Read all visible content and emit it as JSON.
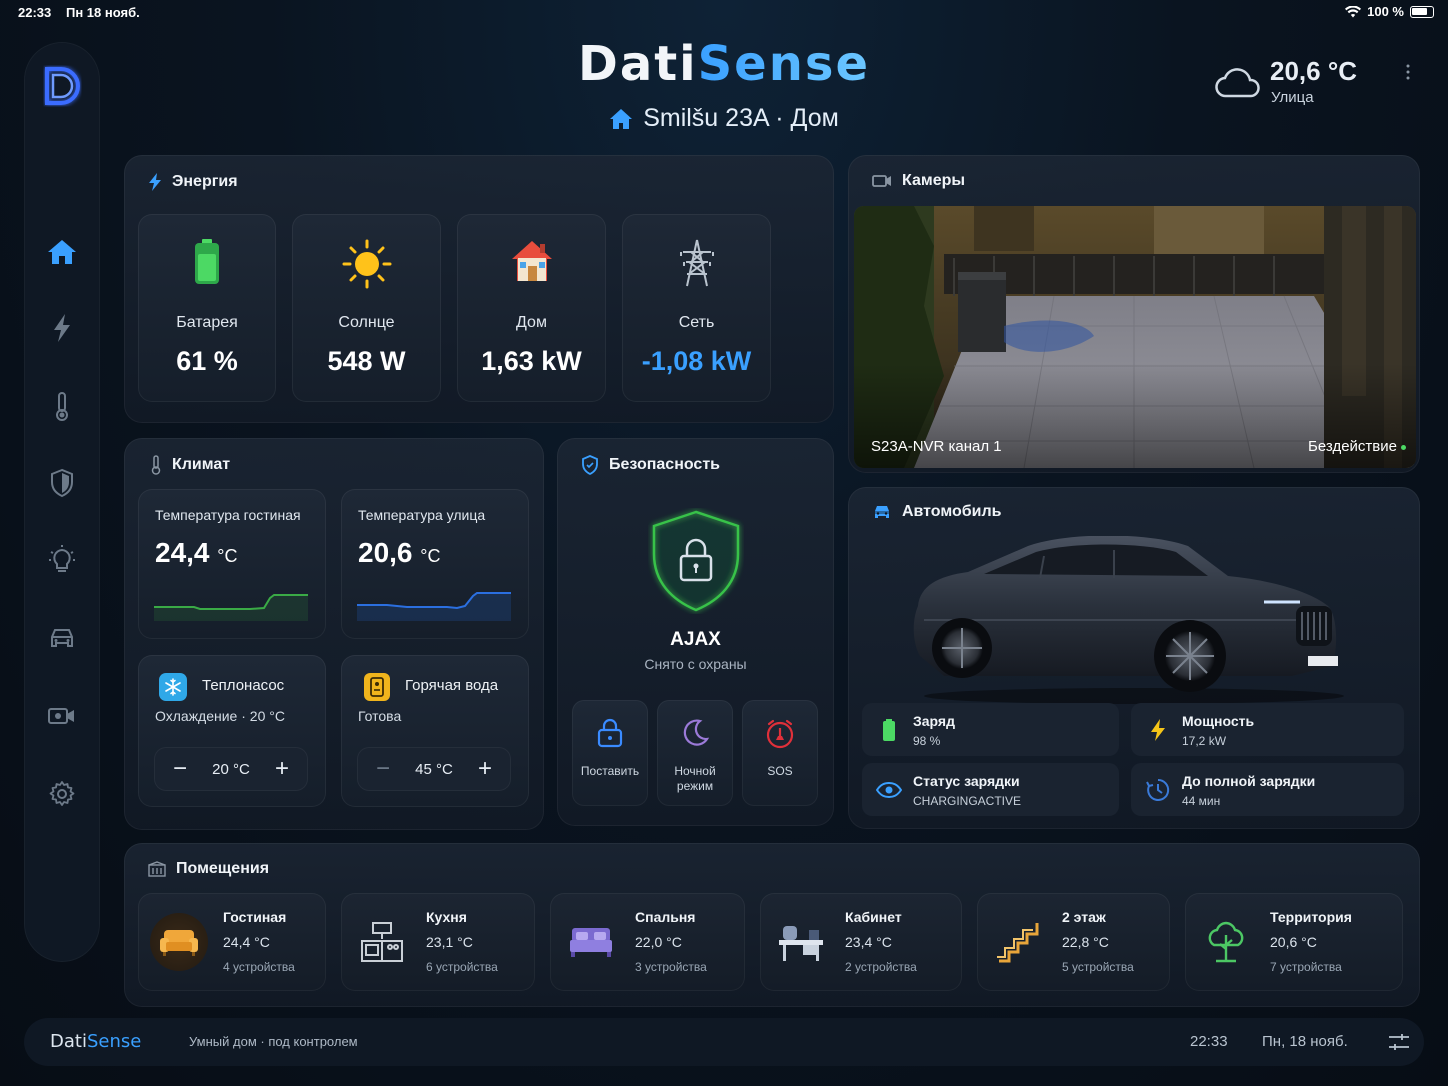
{
  "status_bar": {
    "time": "22:33",
    "date": "Пн 18 нояб.",
    "battery": "100 %"
  },
  "header": {
    "brand_part1": "Dati",
    "brand_part2": "Sense",
    "location": "Smilšu 23A · Дом",
    "weather_temp": "20,6 °C",
    "weather_label": "Улица"
  },
  "energy": {
    "title": "Энергия",
    "tiles": [
      {
        "label": "Батарея",
        "value": "61 %",
        "color": "#ffffff",
        "icon": "battery-icon"
      },
      {
        "label": "Солнце",
        "value": "548 W",
        "color": "#ffffff",
        "icon": "sun-icon"
      },
      {
        "label": "Дом",
        "value": "1,63 kW",
        "color": "#ffffff",
        "icon": "house-icon"
      },
      {
        "label": "Сеть",
        "value": "-1,08 kW",
        "color": "#3aa0ff",
        "icon": "power-tower-icon"
      }
    ]
  },
  "climate": {
    "title": "Климат",
    "living": {
      "label": "Температура гостиная",
      "value": "24,4",
      "unit": "°C"
    },
    "outside": {
      "label": "Температура улица",
      "value": "20,6",
      "unit": "°C"
    },
    "heatpump": {
      "name": "Теплонасос",
      "status": "Охлаждение · 20 °C",
      "setpoint": "20 °C"
    },
    "hotwater": {
      "name": "Горячая вода",
      "status": "Готова",
      "setpoint": "45 °C"
    }
  },
  "security": {
    "title": "Безопасность",
    "system": "AJAX",
    "state": "Снято с охраны",
    "buttons": [
      {
        "label": "Поставить"
      },
      {
        "label": "Ночной режим"
      },
      {
        "label": "SOS"
      }
    ]
  },
  "cameras": {
    "title": "Камеры",
    "channel": "S23A-NVR канал 1",
    "status": "Бездействие"
  },
  "car": {
    "title": "Автомобиль",
    "charge_label": "Заряд",
    "charge_value": "98 %",
    "power_label": "Мощность",
    "power_value": "17,2 kW",
    "charging_status_label": "Статус зарядки",
    "charging_status_value": "CHARGINGACTIVE",
    "full_label": "До полной зарядки",
    "full_value": "44 мин"
  },
  "rooms": {
    "title": "Помещения",
    "items": [
      {
        "name": "Гостиная",
        "temp": "24,4 °C",
        "devices": "4 устройства"
      },
      {
        "name": "Кухня",
        "temp": "23,1 °C",
        "devices": "6 устройства"
      },
      {
        "name": "Спальня",
        "temp": "22,0 °C",
        "devices": "3 устройства"
      },
      {
        "name": "Кабинет",
        "temp": "23,4 °C",
        "devices": "2 устройства"
      },
      {
        "name": "2 этаж",
        "temp": "22,8 °C",
        "devices": "5 устройства"
      },
      {
        "name": "Территория",
        "temp": "20,6 °C",
        "devices": "7 устройства"
      }
    ]
  },
  "footer": {
    "brand_part1": "Dati",
    "brand_part2": "Sense",
    "tagline": "Умный дом · под контролем",
    "time": "22:33",
    "date": "Пн, 18 нояб."
  },
  "colors": {
    "accent": "#3aa0ff",
    "green": "#4cd964",
    "background": "#0a1420"
  }
}
